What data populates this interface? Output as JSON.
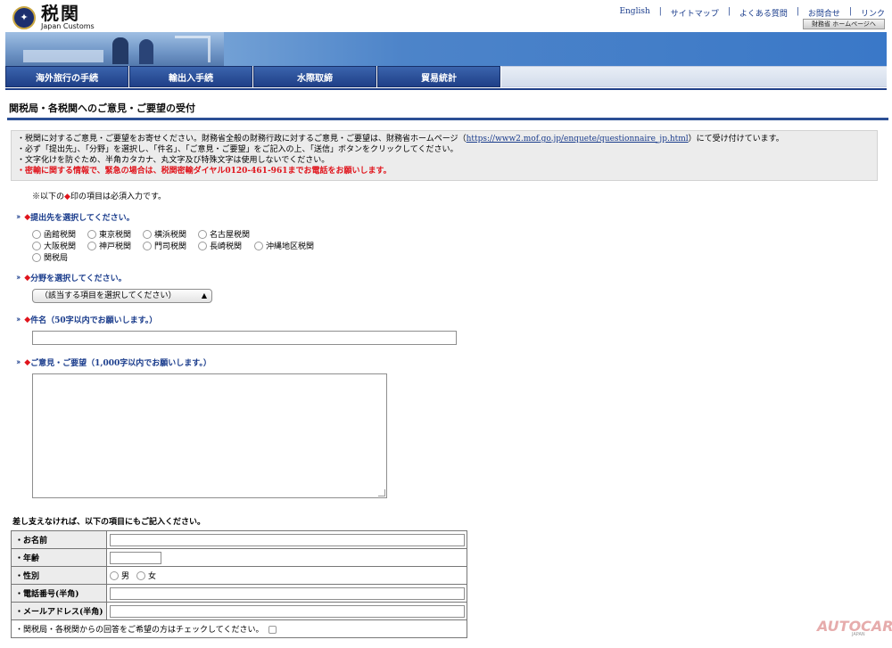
{
  "header": {
    "logo_ja": "税関",
    "logo_en": "Japan Customs",
    "links": [
      "English",
      "サイトマップ",
      "よくある質問",
      "お問合せ",
      "リンク"
    ],
    "mof_button": "財務省 ホームページへ"
  },
  "nav": {
    "items": [
      "海外旅行の手続",
      "輸出入手続",
      "水際取締",
      "貿易統計"
    ]
  },
  "page_title": "関税局・各税関へのご意見・ご要望の受付",
  "notice": {
    "line1_pre": "・税関に対するご意見・ご要望をお寄せください。財務省全般の財務行政に対するご意見・ご要望は、財務省ホームページ（",
    "line1_link": "https://www2.mof.go.jp/enquete/questionnaire_jp.html",
    "line1_post": "）にて受け付けています。",
    "line2": "・必ず「提出先」、「分野」を選択し、「件名」、「ご意見・ご要望」をご記入の上、「送信」ボタンをクリックしてください。",
    "line3": "・文字化けを防ぐため、半角カタカナ、丸文字及び特殊文字は使用しないでください。",
    "line4": "・密輸に関する情報で、緊急の場合は、税関密輸ダイヤル0120-461-961までお電話をお願いします。"
  },
  "required_note": {
    "pre": "※以下の",
    "mark": "◆",
    "post": "印の項目は必須入力です。"
  },
  "form": {
    "q_destination": "提出先を選択してください。",
    "destinations": [
      [
        "函館税関",
        "東京税関",
        "横浜税関",
        "名古屋税関"
      ],
      [
        "大阪税関",
        "神戸税関",
        "門司税関",
        "長崎税関",
        "沖縄地区税関"
      ],
      [
        "関税局"
      ]
    ],
    "q_field": "分野を選択してください。",
    "field_select": "（該当する項目を選択してください）",
    "q_subject": "件名（50字以内でお願いします。）",
    "q_opinion": "ご意見・ご要望（1,000字以内でお願いします。）",
    "required_mark": "◆",
    "arrow": "››"
  },
  "optional": {
    "label": "差し支えなければ、以下の項目にもご記入ください。",
    "name": "・お名前",
    "age": "・年齢",
    "sex": "・性別",
    "sex_male": "男",
    "sex_female": "女",
    "phone": "・電話番号(半角)",
    "email": "・メールアドレス(半角)",
    "reply": "・関税局・各税関からの回答をご希望の方はチェックしてください。"
  },
  "watermark": {
    "brand": "AUTOCAR",
    "sub": "JAPAN"
  }
}
